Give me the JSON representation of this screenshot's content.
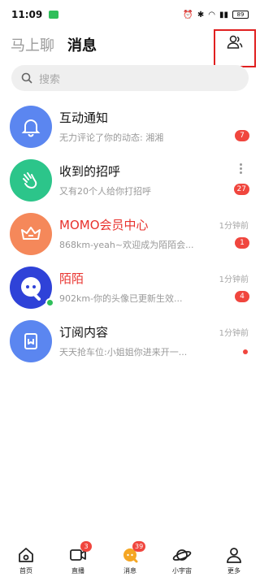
{
  "status_bar": {
    "time": "11:09",
    "battery": "89"
  },
  "header": {
    "tab_chat": "马上聊",
    "tab_messages": "消息"
  },
  "search": {
    "placeholder": "搜索"
  },
  "conversations": [
    {
      "title": "互动通知",
      "subtitle": "无力评论了你的动态: 湘湘",
      "time": "",
      "badge": "7",
      "avatar_color": "#5b86f0",
      "icon": "bell-icon"
    },
    {
      "title": "收到的招呼",
      "subtitle": "又有20个人给你打招呼",
      "time": "",
      "badge": "27",
      "avatar_color": "#2cc58a",
      "icon": "wave-hand-icon"
    },
    {
      "title": "MOMO会员中心",
      "subtitle": "868km-yeah~欢迎成为陌陌会...",
      "time": "1分钟前",
      "badge": "1",
      "avatar_color": "#f5885a",
      "icon": "crown-icon"
    },
    {
      "title": "陌陌",
      "subtitle": "902km-你的头像已更新生效...",
      "time": "1分钟前",
      "badge": "4",
      "avatar_color": "#2f42d8",
      "icon": "momo-logo-icon"
    },
    {
      "title": "订阅内容",
      "subtitle": "天天抢车位:小姐姐你进来开一...",
      "time": "1分钟前",
      "badge": "",
      "avatar_color": "#5b86f0",
      "icon": "bookmark-icon"
    }
  ],
  "bottom_nav": [
    {
      "label": "首页",
      "badge": ""
    },
    {
      "label": "直播",
      "badge": "3"
    },
    {
      "label": "消息",
      "badge": "39"
    },
    {
      "label": "小宇宙",
      "badge": ""
    },
    {
      "label": "更多",
      "badge": ""
    }
  ],
  "colors": {
    "accent_red": "#f0463e",
    "online_green": "#2fbf5a",
    "highlight_box": "#e02020"
  }
}
